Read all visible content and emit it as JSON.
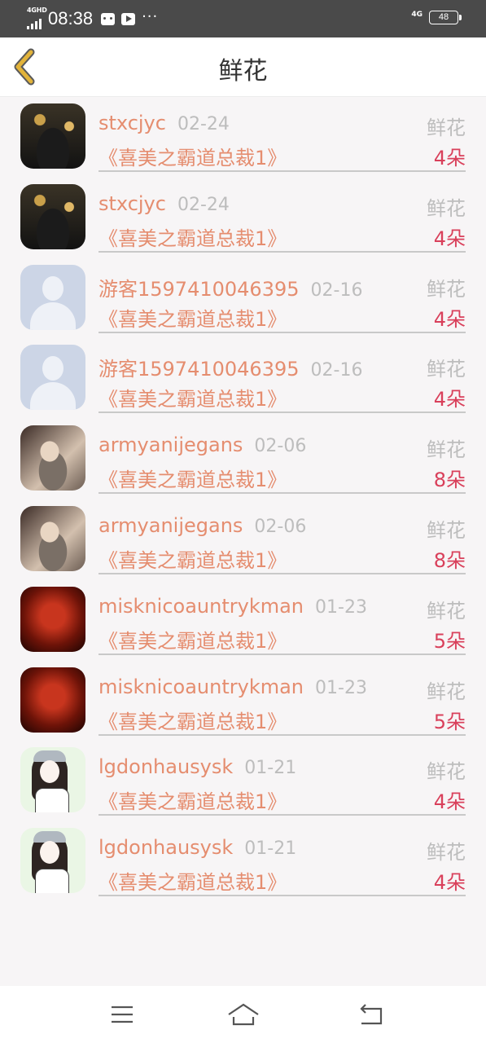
{
  "status_bar": {
    "network_small": "4GHD",
    "time": "08:38",
    "more": "···",
    "network_right": "4G",
    "battery": "48"
  },
  "header": {
    "title": "鲜花"
  },
  "items": [
    {
      "user": "stxcjyc",
      "date": "02-24",
      "gift_type": "鲜花",
      "book": "《喜美之霸道总裁1》",
      "quantity": "4朵",
      "avatar": "dark-photo"
    },
    {
      "user": "stxcjyc",
      "date": "02-24",
      "gift_type": "鲜花",
      "book": "《喜美之霸道总裁1》",
      "quantity": "4朵",
      "avatar": "dark-photo"
    },
    {
      "user": "游客1597410046395",
      "date": "02-16",
      "gift_type": "鲜花",
      "book": "《喜美之霸道总裁1》",
      "quantity": "4朵",
      "avatar": "guest-silhouette"
    },
    {
      "user": "游客1597410046395",
      "date": "02-16",
      "gift_type": "鲜花",
      "book": "《喜美之霸道总裁1》",
      "quantity": "4朵",
      "avatar": "guest-silhouette"
    },
    {
      "user": "armyanijegans",
      "date": "02-06",
      "gift_type": "鲜花",
      "book": "《喜美之霸道总裁1》",
      "quantity": "8朵",
      "avatar": "scarf-photo"
    },
    {
      "user": "armyanijegans",
      "date": "02-06",
      "gift_type": "鲜花",
      "book": "《喜美之霸道总裁1》",
      "quantity": "8朵",
      "avatar": "scarf-photo"
    },
    {
      "user": "misknicoauntrykman",
      "date": "01-23",
      "gift_type": "鲜花",
      "book": "《喜美之霸道总裁1》",
      "quantity": "5朵",
      "avatar": "red-text-photo"
    },
    {
      "user": "misknicoauntrykman",
      "date": "01-23",
      "gift_type": "鲜花",
      "book": "《喜美之霸道总裁1》",
      "quantity": "5朵",
      "avatar": "red-text-photo"
    },
    {
      "user": "lgdonhausysk",
      "date": "01-21",
      "gift_type": "鲜花",
      "book": "《喜美之霸道总裁1》",
      "quantity": "4朵",
      "avatar": "girl-illustration"
    },
    {
      "user": "lgdonhausysk",
      "date": "01-21",
      "gift_type": "鲜花",
      "book": "《喜美之霸道总裁1》",
      "quantity": "4朵",
      "avatar": "girl-illustration"
    }
  ],
  "colors": {
    "accent_orange": "#e58d6f",
    "quantity_red": "#d9405b",
    "muted_gray": "#bdbdbd",
    "back_arrow": "#e2b33a"
  },
  "nav_icons": [
    "menu-icon",
    "home-icon",
    "back-icon"
  ]
}
